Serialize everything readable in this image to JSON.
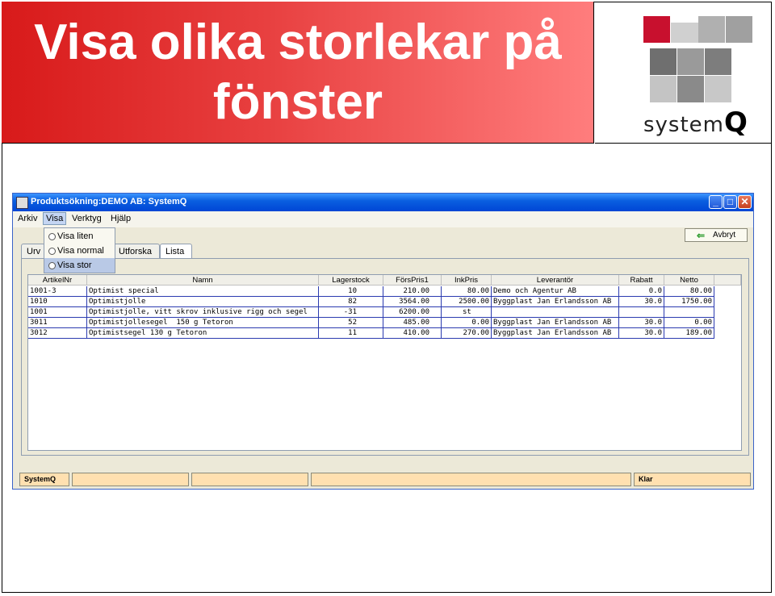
{
  "slide": {
    "title_line1": "Visa olika storlekar på",
    "title_line2": "fönster",
    "logo_text": "system",
    "logo_letter": "Q"
  },
  "window": {
    "title": "Produktsökning:DEMO AB: SystemQ",
    "controls": [
      "_",
      "□",
      "✕"
    ]
  },
  "menubar": [
    "Arkiv",
    "Visa",
    "Verktyg",
    "Hjälp"
  ],
  "visa_menu": [
    "Visa liten",
    "Visa normal",
    "Visa stor"
  ],
  "tabs": [
    "Urv",
    "Utforska",
    "Lista"
  ],
  "toolbar": {
    "cancel_label": "Avbryt"
  },
  "table": {
    "columns": [
      "ArtikelNr",
      "Namn",
      "Lagerstock",
      "FörsPris1",
      "InkPris",
      "Leverantör",
      "Rabatt",
      "Netto"
    ],
    "rows": [
      [
        "1001-3",
        "Optimist special",
        "10",
        "210.00",
        "80.00",
        "Demo och Agentur AB",
        "0.0",
        "80.00"
      ],
      [
        "1010",
        "Optimistjolle",
        "82",
        "3564.00",
        "2500.00",
        "Byggplast Jan Erlandsson AB",
        "30.0",
        "1750.00"
      ],
      [
        "1001",
        "Optimistjolle, vitt skrov inklusive rigg och segel",
        "-31",
        "6200.00",
        "st",
        "",
        "",
        ""
      ],
      [
        "3011",
        "Optimistjollesegel  150 g Tetoron",
        "52",
        "485.00",
        "0.00",
        "Byggplast Jan Erlandsson AB",
        "30.0",
        "0.00"
      ],
      [
        "3012",
        "Optimistsegel 130 g Tetoron",
        "11",
        "410.00",
        "270.00",
        "Byggplast Jan Erlandsson AB",
        "30.0",
        "189.00"
      ]
    ]
  },
  "statusbar": {
    "app": "SystemQ",
    "state": "Klar"
  },
  "colors": {
    "banner_red": "#d81a1a",
    "titlebar_blue": "#0a5fe0",
    "status_orange": "#ffe0b0"
  }
}
